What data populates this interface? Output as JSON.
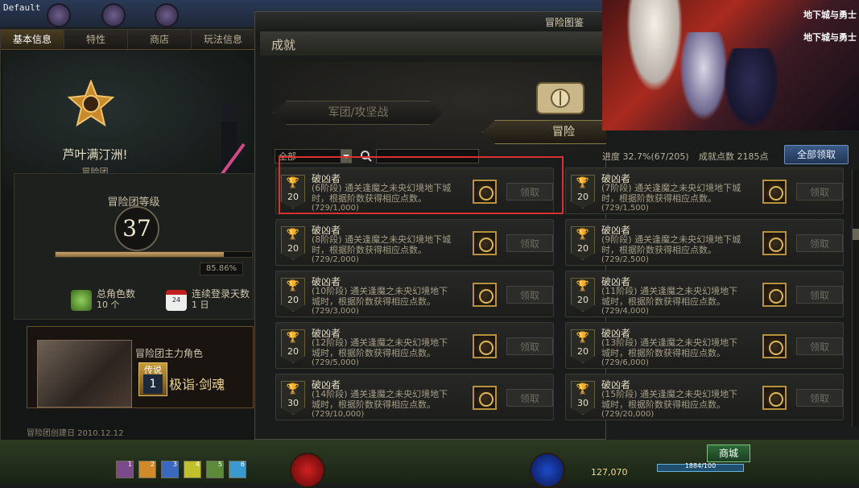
{
  "top": {
    "profile_label": "Default"
  },
  "left_panel": {
    "tabs": [
      "基本信息",
      "特性",
      "商店",
      "玩法信息"
    ],
    "guild_name": "芦叶满汀洲!",
    "guild_type": "冒险团",
    "level_label": "冒险团等级",
    "level": "37",
    "xp_percent_text": "85.86%",
    "xp_fraction": 0.8586,
    "stat1_label": "总角色数",
    "stat1_value": "10 个",
    "stat2_label": "连续登录天数",
    "stat2_value": "1 日",
    "calendar_num": "24",
    "main_char_title": "冒险团主力角色",
    "legend_badge": "传说",
    "legend_num": "1",
    "main_char_class": "极诣·剑魂",
    "founded": "冒险团创建日 2010.12.12"
  },
  "window": {
    "title": "冒险图鉴",
    "section": "成就",
    "tab1": "军团/攻坚战",
    "tab2": "冒险",
    "filter": "全部",
    "progress": "进度 32.7%(67/205)",
    "points": "成就点数 2185点",
    "claim_all": "全部领取"
  },
  "cards": [
    {
      "title": "破凶者",
      "desc": "(6阶段) 通关逢魔之未央幻境地下城时，根据阶数获得相应点数。",
      "progress": "(729/1,000)",
      "points": "20",
      "claim": "领取"
    },
    {
      "title": "破凶者",
      "desc": "(7阶段) 通关逢魔之未央幻境地下城时，根据阶数获得相应点数。",
      "progress": "(729/1,500)",
      "points": "20",
      "claim": "领取"
    },
    {
      "title": "破凶者",
      "desc": "(8阶段) 通关逢魔之未央幻境地下城时，根据阶数获得相应点数。",
      "progress": "(729/2,000)",
      "points": "20",
      "claim": "领取"
    },
    {
      "title": "破凶者",
      "desc": "(9阶段) 通关逢魔之未央幻境地下城时，根据阶数获得相应点数。",
      "progress": "(729/2,500)",
      "points": "20",
      "claim": "领取"
    },
    {
      "title": "破凶者",
      "desc": "(10阶段) 通关逢魔之未央幻境地下城时，根据阶数获得相应点数。",
      "progress": "(729/3,000)",
      "points": "20",
      "claim": "领取"
    },
    {
      "title": "破凶者",
      "desc": "(11阶段) 通关逢魔之未央幻境地下城时，根据阶数获得相应点数。",
      "progress": "(729/4,000)",
      "points": "20",
      "claim": "领取"
    },
    {
      "title": "破凶者",
      "desc": "(12阶段) 通关逢魔之未央幻境地下城时，根据阶数获得相应点数。",
      "progress": "(729/5,000)",
      "points": "20",
      "claim": "领取"
    },
    {
      "title": "破凶者",
      "desc": "(13阶段) 通关逢魔之未央幻境地下城时，根据阶数获得相应点数。",
      "progress": "(729/6,000)",
      "points": "20",
      "claim": "领取"
    },
    {
      "title": "破凶者",
      "desc": "(14阶段) 通关逢魔之未央幻境地下城时，根据阶数获得相应点数。",
      "progress": "(729/10,000)",
      "points": "30",
      "claim": "领取"
    },
    {
      "title": "破凶者",
      "desc": "(15阶段) 通关逢魔之未央幻境地下城时，根据阶数获得相应点数。",
      "progress": "(729/20,000)",
      "points": "30",
      "claim": "领取"
    }
  ],
  "hud": {
    "gold": "127,070",
    "shop": "商城",
    "hp_text": "1884/100",
    "skill_nums": [
      "1",
      "2",
      "3",
      "4",
      "5",
      "6"
    ]
  },
  "colors": {
    "highlight": "#d8312f",
    "accent_gold": "#b8913f",
    "claim_all_blue": "#3a5a86"
  },
  "icons": [
    "trophy-icon",
    "reward-emblem-icon",
    "search-icon",
    "dropdown-arrow-icon",
    "calendar-icon",
    "characters-icon"
  ]
}
